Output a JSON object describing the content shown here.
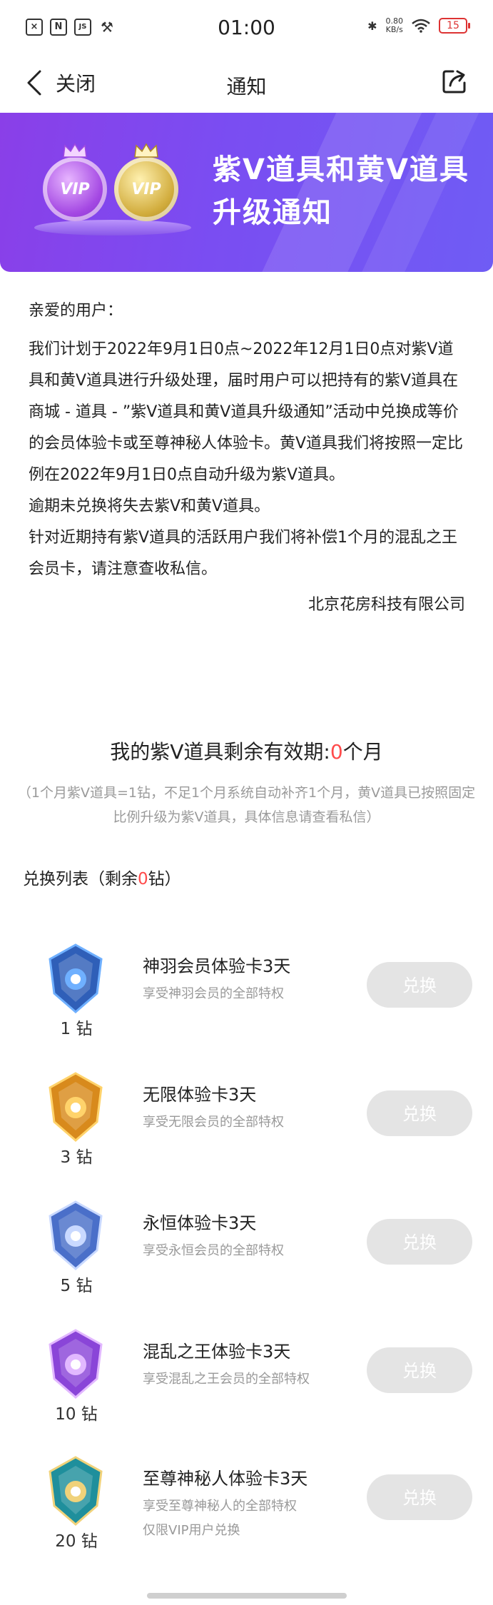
{
  "status_bar": {
    "time": "01:00",
    "left_icons": [
      "x-box-icon",
      "n-box-icon",
      "js-box-icon",
      "tools-icon"
    ],
    "network_speed_value": "0.80",
    "network_speed_unit": "KB/s",
    "battery": "15"
  },
  "nav": {
    "back_label": "关闭",
    "title": "通知"
  },
  "banner": {
    "title_line1": "紫V道具和黄V道具",
    "title_line2": "升级通知",
    "badge_text": "VIP"
  },
  "notice": {
    "greeting": "亲爱的用户：",
    "paragraphs": [
      "我们计划于2022年9月1日0点~2022年12月1日0点对紫V道具和黄V道具进行升级处理，届时用户可以把持有的紫V道具在商城 - 道具 - ”紫V道具和黄V道具升级通知”活动中兑换成等价的会员体验卡或至尊神秘人体验卡。黄V道具我们将按照一定比例在2022年9月1日0点自动升级为紫V道具。",
      "逾期未兑换将失去紫V和黄V道具。",
      "针对近期持有紫V道具的活跃用户我们将补偿1个月的混乱之王会员卡，请注意查收私信。"
    ],
    "signature": "北京花房科技有限公司"
  },
  "remaining": {
    "prefix": "我的紫V道具剩余有效期:",
    "value": "0",
    "suffix": "个月",
    "note": "（1个月紫V道具=1钻，不足1个月系统自动补齐1个月，黄V道具已按照固定比例升级为紫V道具，具体信息请查看私信）"
  },
  "exchange_list": {
    "title_prefix": "兑换列表（剩余",
    "remaining_value": "0",
    "title_suffix": "钻）",
    "button_label": "兑换",
    "items": [
      {
        "name": "神羽会员体验卡3天",
        "desc": "享受神羽会员的全部特权",
        "extra": "",
        "cost": "1 钻",
        "color": "#2f5fb8",
        "accent": "#6fb0ff"
      },
      {
        "name": "无限体验卡3天",
        "desc": "享受无限会员的全部特权",
        "extra": "",
        "cost": "3 钻",
        "color": "#d88a1c",
        "accent": "#ffd36b"
      },
      {
        "name": "永恒体验卡3天",
        "desc": "享受永恒会员的全部特权",
        "extra": "",
        "cost": "5 钻",
        "color": "#4a6fc9",
        "accent": "#c9d9ff"
      },
      {
        "name": "混乱之王体验卡3天",
        "desc": "享受混乱之王会员的全部特权",
        "extra": "",
        "cost": "10 钻",
        "color": "#8a45d8",
        "accent": "#e2b8ff"
      },
      {
        "name": "至尊神秘人体验卡3天",
        "desc": "享受至尊神秘人的全部特权",
        "extra": "仅限VIP用户兑换",
        "cost": "20 钻",
        "color": "#1f8f9c",
        "accent": "#f0d27a"
      }
    ]
  }
}
